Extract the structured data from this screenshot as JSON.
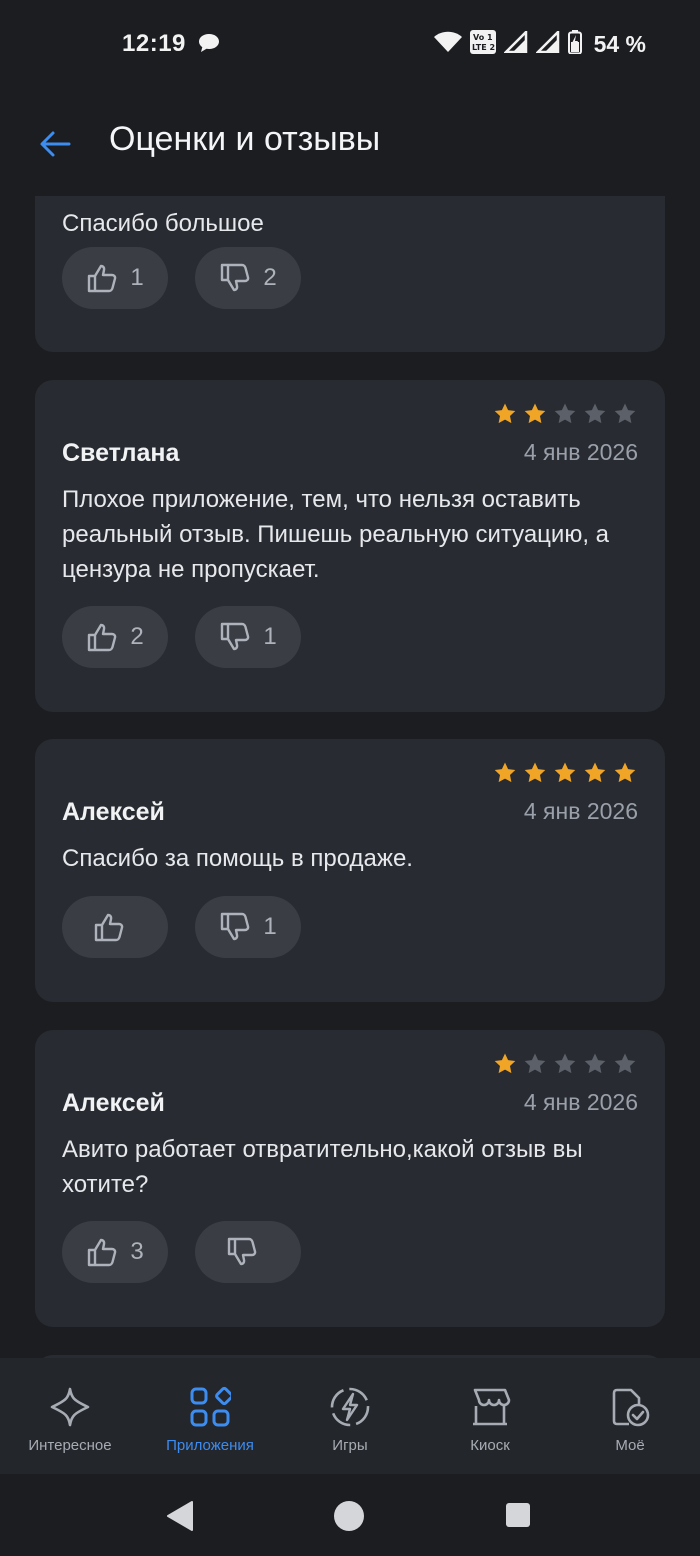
{
  "status_bar": {
    "time": "12:19",
    "battery": "54 %",
    "volte_label": "Vo LTE"
  },
  "header": {
    "title": "Оценки и отзывы"
  },
  "reviews": [
    {
      "author": "",
      "date": "",
      "rating": null,
      "text": "Спасибо большое",
      "likes": "1",
      "dislikes": "2"
    },
    {
      "author": "Светлана",
      "date": "4 янв 2026",
      "rating": 2,
      "text": "Плохое приложение, тем, что нельзя оставить реальный отзыв. Пишешь реальную ситуацию, а цензура не пропускает.",
      "likes": "2",
      "dislikes": "1"
    },
    {
      "author": "Алексей",
      "date": "4 янв 2026",
      "rating": 5,
      "text": "Спасибо за помощь в продаже.",
      "likes": "",
      "dislikes": "1"
    },
    {
      "author": "Алексей",
      "date": "4 янв 2026",
      "rating": 1,
      "text": "Авито работает отвратительно,какой отзыв вы хотите?",
      "likes": "3",
      "dislikes": ""
    }
  ],
  "bottom_nav": {
    "items": [
      {
        "label": "Интересное",
        "icon": "sparkle-icon",
        "active": false
      },
      {
        "label": "Приложения",
        "icon": "apps-grid-icon",
        "active": true
      },
      {
        "label": "Игры",
        "icon": "lightning-icon",
        "active": false
      },
      {
        "label": "Киоск",
        "icon": "kiosk-store-icon",
        "active": false
      },
      {
        "label": "Моё",
        "icon": "my-apps-icon",
        "active": false
      }
    ]
  },
  "colors": {
    "background": "#1b1d21",
    "card": "#282b31",
    "accent": "#3d8cf0",
    "star_filled": "#f0a526",
    "star_empty": "#5b6069"
  }
}
